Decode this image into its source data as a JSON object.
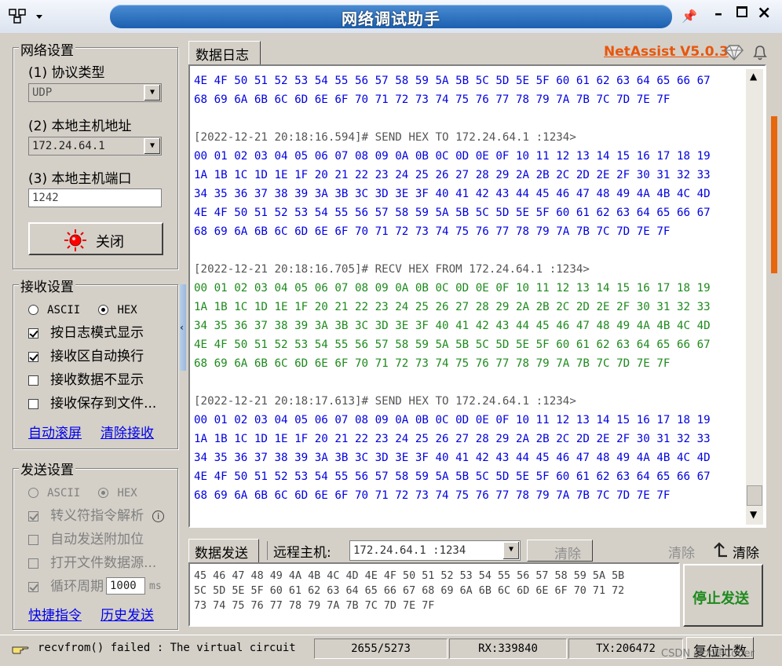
{
  "window": {
    "title": "网络调试助手",
    "version": "NetAssist V5.0.3"
  },
  "network_settings": {
    "group_label": "网络设置",
    "protocol_label": "(1) 协议类型",
    "protocol_value": "UDP",
    "host_label": "(2) 本地主机地址",
    "host_value": "172.24.64.1",
    "port_label": "(3) 本地主机端口",
    "port_value": "1242",
    "close_button": "关闭"
  },
  "receive_settings": {
    "group_label": "接收设置",
    "ascii_label": "ASCII",
    "hex_label": "HEX",
    "log_mode": "按日志模式显示",
    "auto_wrap": "接收区自动换行",
    "hide_data": "接收数据不显示",
    "save_to_file": "接收保存到文件...",
    "auto_scroll": "自动滚屏",
    "clear_receive": "清除接收"
  },
  "send_settings": {
    "group_label": "发送设置",
    "ascii_label": "ASCII",
    "hex_label": "HEX",
    "escape_parse": "转义符指令解析",
    "auto_append": "自动发送附加位",
    "open_file": "打开文件数据源...",
    "loop_period": "循环周期",
    "loop_value": "1000",
    "loop_unit": "ms",
    "quick_cmd": "快捷指令",
    "history": "历史发送"
  },
  "log_tab": "数据日志",
  "log_lines": [
    {
      "kind": "send",
      "text": "4E 4F 50 51 52 53 54 55 56 57 58 59 5A 5B 5C 5D 5E 5F 60 61 62 63 64 65 66 67"
    },
    {
      "kind": "send",
      "text": "68 69 6A 6B 6C 6D 6E 6F 70 71 72 73 74 75 76 77 78 79 7A 7B 7C 7D 7E 7F"
    },
    {
      "kind": "blank",
      "text": ""
    },
    {
      "kind": "hdr",
      "text": "[2022-12-21 20:18:16.594]# SEND HEX TO 172.24.64.1 :1234>"
    },
    {
      "kind": "send",
      "text": "00 01 02 03 04 05 06 07 08 09 0A 0B 0C 0D 0E 0F 10 11 12 13 14 15 16 17 18 19"
    },
    {
      "kind": "send",
      "text": "1A 1B 1C 1D 1E 1F 20 21 22 23 24 25 26 27 28 29 2A 2B 2C 2D 2E 2F 30 31 32 33"
    },
    {
      "kind": "send",
      "text": "34 35 36 37 38 39 3A 3B 3C 3D 3E 3F 40 41 42 43 44 45 46 47 48 49 4A 4B 4C 4D"
    },
    {
      "kind": "send",
      "text": "4E 4F 50 51 52 53 54 55 56 57 58 59 5A 5B 5C 5D 5E 5F 60 61 62 63 64 65 66 67"
    },
    {
      "kind": "send",
      "text": "68 69 6A 6B 6C 6D 6E 6F 70 71 72 73 74 75 76 77 78 79 7A 7B 7C 7D 7E 7F"
    },
    {
      "kind": "blank",
      "text": ""
    },
    {
      "kind": "hdr",
      "text": "[2022-12-21 20:18:16.705]# RECV HEX FROM 172.24.64.1 :1234>"
    },
    {
      "kind": "recv",
      "text": "00 01 02 03 04 05 06 07 08 09 0A 0B 0C 0D 0E 0F 10 11 12 13 14 15 16 17 18 19"
    },
    {
      "kind": "recv",
      "text": "1A 1B 1C 1D 1E 1F 20 21 22 23 24 25 26 27 28 29 2A 2B 2C 2D 2E 2F 30 31 32 33"
    },
    {
      "kind": "recv",
      "text": "34 35 36 37 38 39 3A 3B 3C 3D 3E 3F 40 41 42 43 44 45 46 47 48 49 4A 4B 4C 4D"
    },
    {
      "kind": "recv",
      "text": "4E 4F 50 51 52 53 54 55 56 57 58 59 5A 5B 5C 5D 5E 5F 60 61 62 63 64 65 66 67"
    },
    {
      "kind": "recv",
      "text": "68 69 6A 6B 6C 6D 6E 6F 70 71 72 73 74 75 76 77 78 79 7A 7B 7C 7D 7E 7F"
    },
    {
      "kind": "blank",
      "text": ""
    },
    {
      "kind": "hdr",
      "text": "[2022-12-21 20:18:17.613]# SEND HEX TO 172.24.64.1 :1234>"
    },
    {
      "kind": "send",
      "text": "00 01 02 03 04 05 06 07 08 09 0A 0B 0C 0D 0E 0F 10 11 12 13 14 15 16 17 18 19"
    },
    {
      "kind": "send",
      "text": "1A 1B 1C 1D 1E 1F 20 21 22 23 24 25 26 27 28 29 2A 2B 2C 2D 2E 2F 30 31 32 33"
    },
    {
      "kind": "send",
      "text": "34 35 36 37 38 39 3A 3B 3C 3D 3E 3F 40 41 42 43 44 45 46 47 48 49 4A 4B 4C 4D"
    },
    {
      "kind": "send",
      "text": "4E 4F 50 51 52 53 54 55 56 57 58 59 5A 5B 5C 5D 5E 5F 60 61 62 63 64 65 66 67"
    },
    {
      "kind": "send",
      "text": "68 69 6A 6B 6C 6D 6E 6F 70 71 72 73 74 75 76 77 78 79 7A 7B 7C 7D 7E 7F"
    }
  ],
  "send_area": {
    "tab": "数据发送",
    "remote_label": "远程主机:",
    "remote_value": "172.24.64.1 :1234",
    "clear_button": "清除",
    "clear_gray": "清除",
    "clear_right": "清除",
    "send_text": "45 46 47 48 49 4A 4B 4C 4D 4E 4F 50 51 52 53 54 55 56 57 58 59 5A 5B\n5C 5D 5E 5F 60 61 62 63 64 65 66 67 68 69 6A 6B 6C 6D 6E 6F 70 71 72\n73 74 75 76 77 78 79 7A 7B 7C 7D 7E 7F",
    "stop_send": "停止发送"
  },
  "status": {
    "message": "recvfrom() failed : The virtual circuit",
    "counter": "2655/5273",
    "rx": "RX:339840",
    "tx": "TX:206472",
    "reset": "复位计数",
    "watermark": "CSDN @大熊Coder"
  }
}
